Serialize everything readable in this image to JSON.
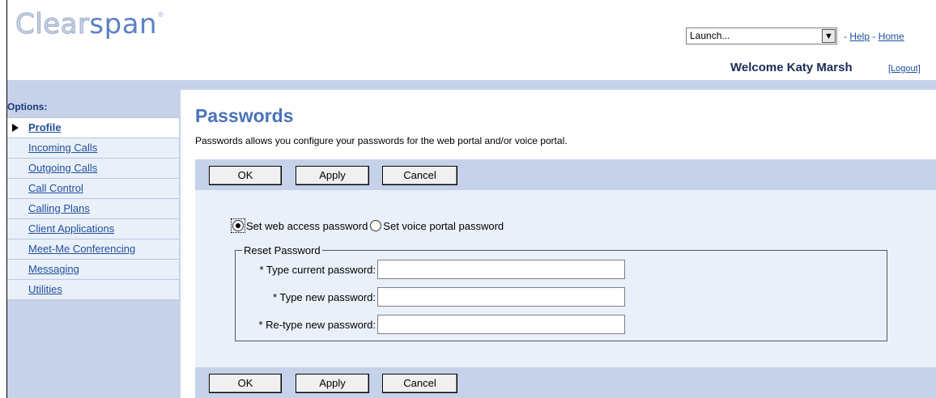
{
  "header": {
    "logo_part1": "Clear",
    "logo_part2": "span",
    "logo_mark": "®",
    "launch_value": "Launch...",
    "launch_arrow_icon": "chevron-down-icon",
    "help_link": "Help",
    "home_link": "Home",
    "separator": "-",
    "welcome": "Welcome Katy Marsh",
    "logout": "[Logout]"
  },
  "sidebar": {
    "title": "Options:",
    "items": [
      {
        "label": "Profile",
        "active": true
      },
      {
        "label": "Incoming Calls",
        "active": false
      },
      {
        "label": "Outgoing Calls",
        "active": false
      },
      {
        "label": "Call Control",
        "active": false
      },
      {
        "label": "Calling Plans",
        "active": false
      },
      {
        "label": "Client Applications",
        "active": false
      },
      {
        "label": "Meet-Me Conferencing",
        "active": false
      },
      {
        "label": "Messaging",
        "active": false
      },
      {
        "label": "Utilities",
        "active": false
      }
    ]
  },
  "main": {
    "title": "Passwords",
    "description": "Passwords allows you configure your passwords for the web portal and/or voice portal.",
    "buttons": {
      "ok": "OK",
      "apply": "Apply",
      "cancel": "Cancel"
    },
    "radio_web": "Set web access password",
    "radio_voice": "Set voice portal password",
    "selected_radio": "web",
    "legend": "Reset Password",
    "fields": {
      "current": "* Type current password:",
      "new": "* Type new password:",
      "retype": "* Re-type new password:"
    },
    "values": {
      "current": "",
      "new": "",
      "retype": ""
    }
  },
  "colors": {
    "accent_blue": "#4a72b8",
    "bar_blue": "#c5d2ea",
    "content_bg": "#eaf0f9",
    "link": "#1f4f9c"
  }
}
